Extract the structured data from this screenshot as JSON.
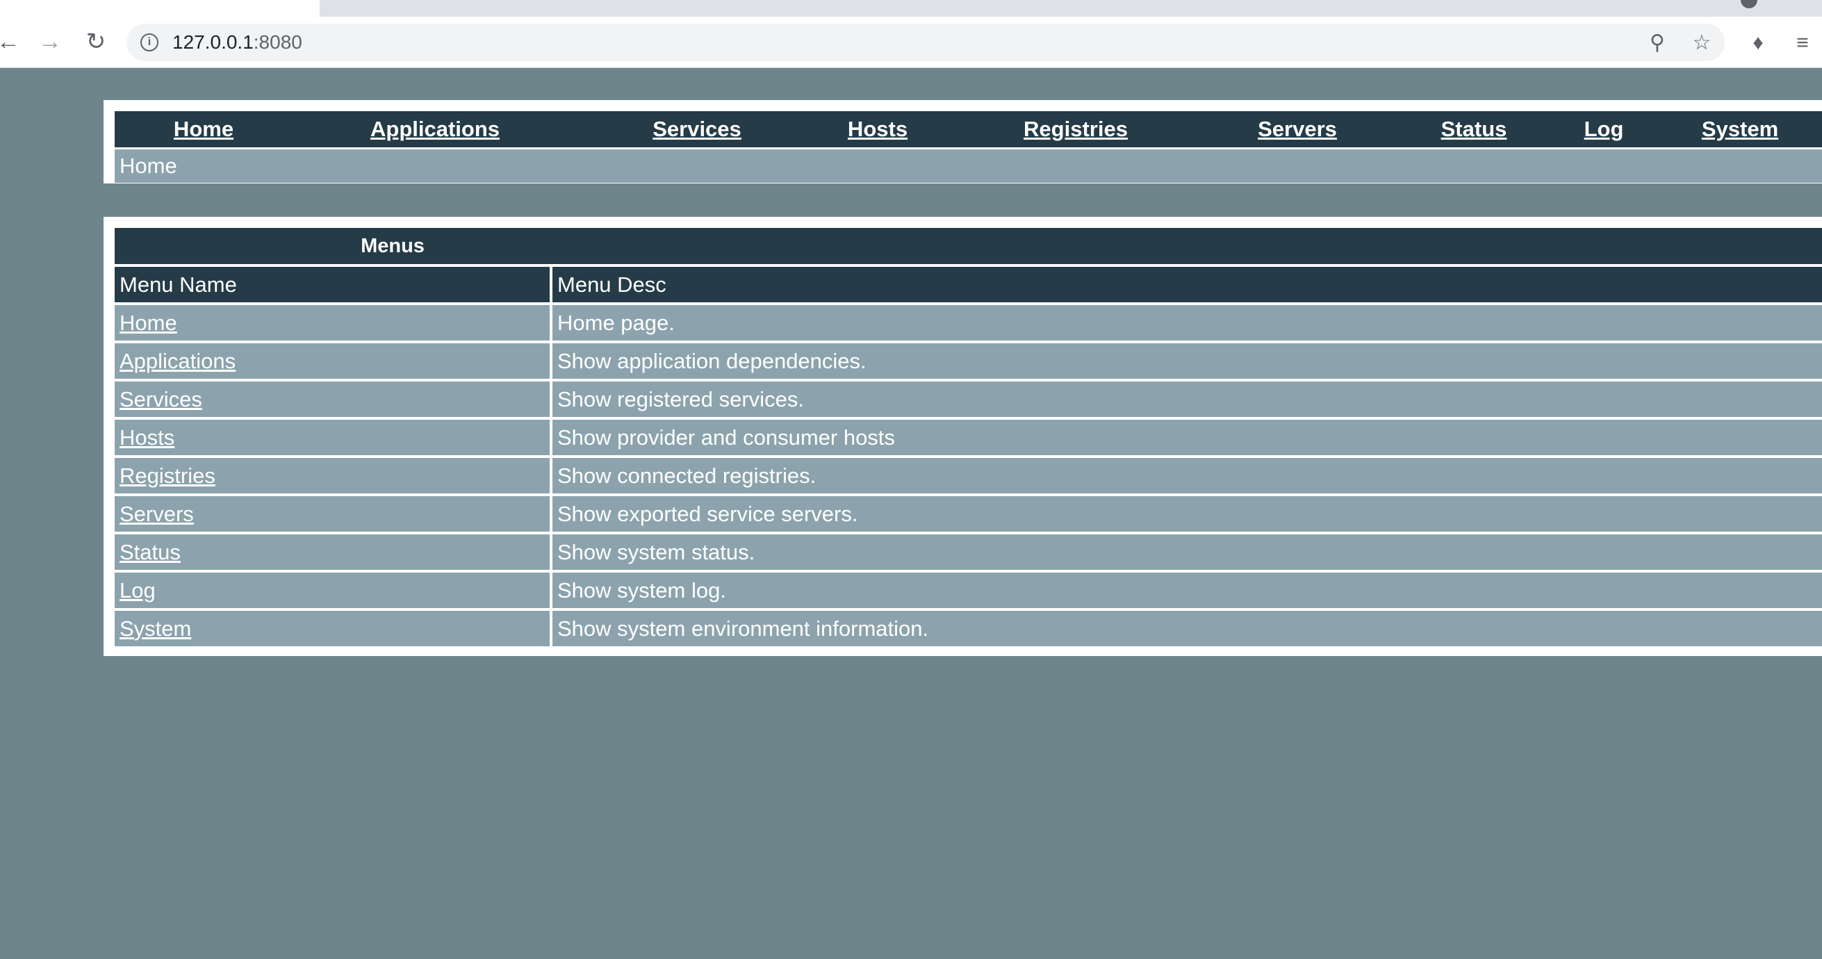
{
  "browser": {
    "url_host": "127.0.0.1",
    "url_port": ":8080"
  },
  "nav": {
    "items": [
      "Home",
      "Applications",
      "Services",
      "Hosts",
      "Registries",
      "Servers",
      "Status",
      "Log",
      "System"
    ],
    "breadcrumb": "Home"
  },
  "menus": {
    "title": "Menus",
    "columns": [
      "Menu Name",
      "Menu Desc"
    ],
    "rows": [
      {
        "name": "Home",
        "desc": "Home page."
      },
      {
        "name": "Applications",
        "desc": "Show application dependencies."
      },
      {
        "name": "Services",
        "desc": "Show registered services."
      },
      {
        "name": "Hosts",
        "desc": "Show provider and consumer hosts"
      },
      {
        "name": "Registries",
        "desc": "Show connected registries."
      },
      {
        "name": "Servers",
        "desc": "Show exported service servers."
      },
      {
        "name": "Status",
        "desc": "Show system status."
      },
      {
        "name": "Log",
        "desc": "Show system log."
      },
      {
        "name": "System",
        "desc": "Show system environment information."
      }
    ]
  },
  "colors": {
    "page_bg": "#6e858c",
    "header_dark": "#253b47",
    "row_bg": "#8ca3ad"
  }
}
